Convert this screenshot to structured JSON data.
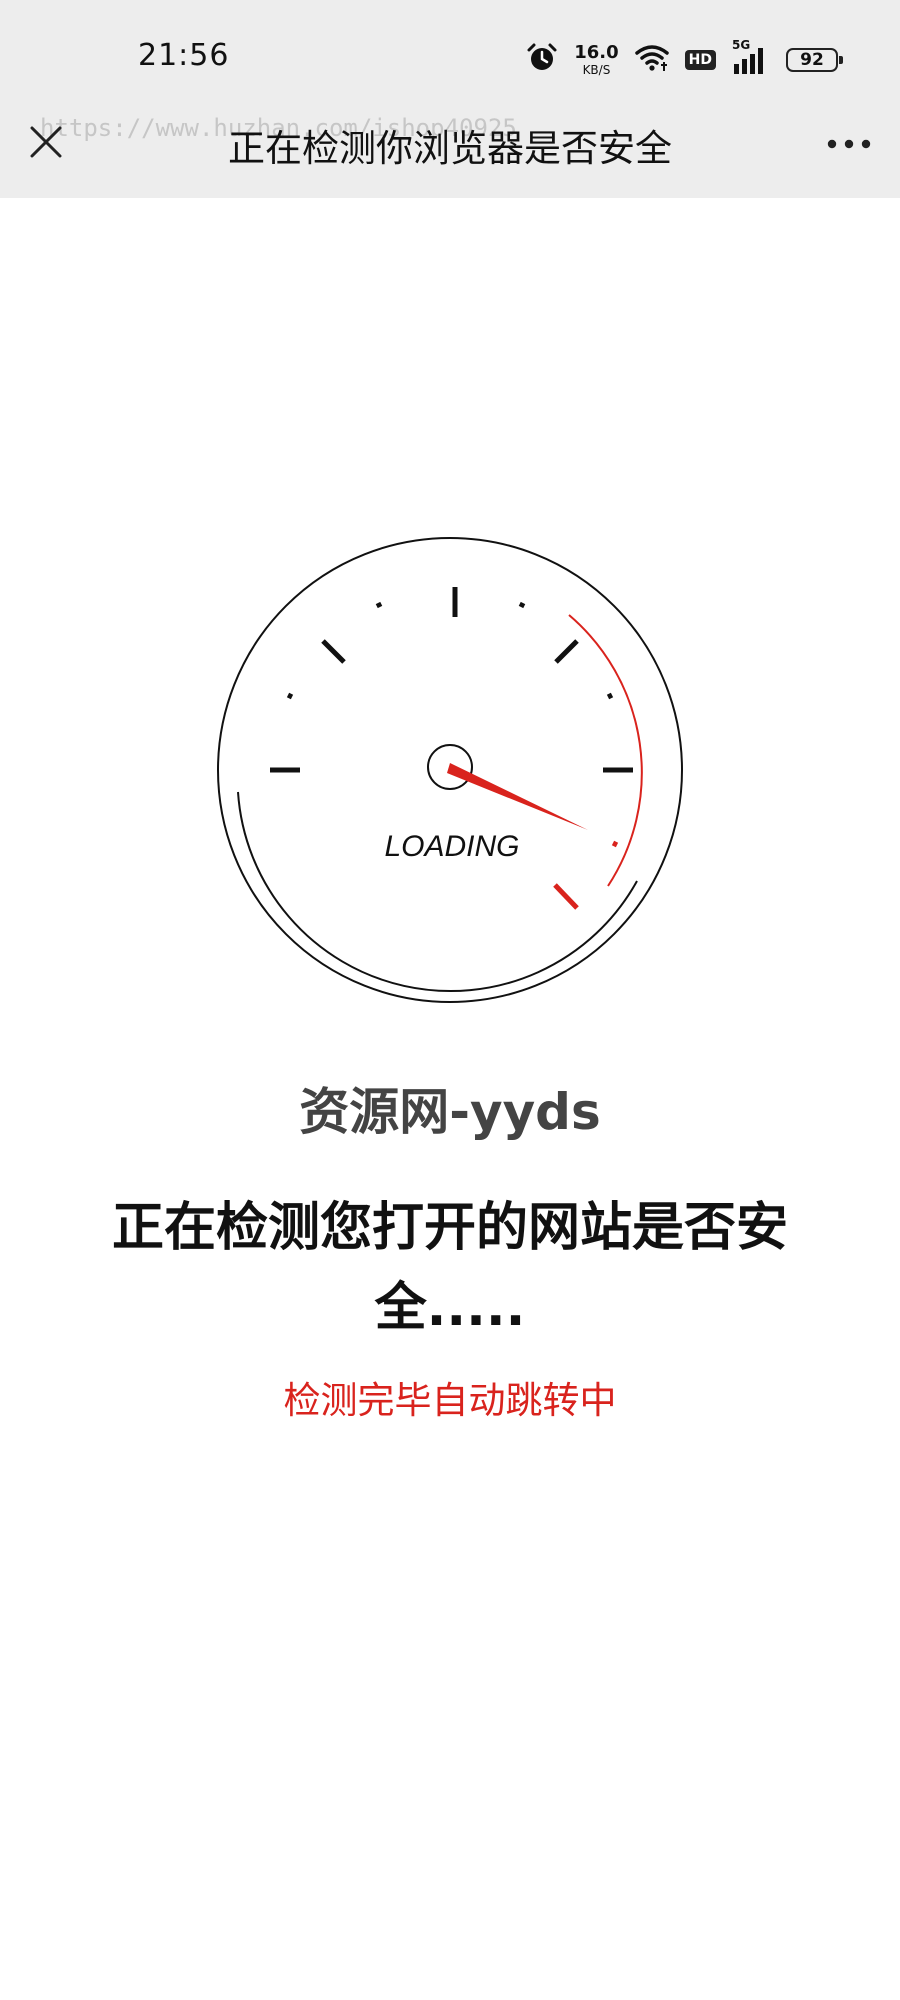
{
  "status_bar": {
    "time": "21:56",
    "net_speed_value": "16.0",
    "net_speed_unit": "KB/S",
    "hd_label": "HD",
    "signal_label": "5G",
    "battery": "92",
    "icons": [
      "alarm-icon",
      "wifi-icon",
      "signal-icon",
      "battery-icon"
    ]
  },
  "nav": {
    "title": "正在检测你浏览器是否安全",
    "watermark": "https://www.huzhan.com/ishop40925",
    "close_icon": "close-icon",
    "more_icon": "more-icon"
  },
  "gauge": {
    "label": "LOADING",
    "accent_color": "#d9231d"
  },
  "content": {
    "site_name": "资源网-yyds",
    "checking_message": "正在检测您打开的网站是否安全.....",
    "redirect_message": "检测完毕自动跳转中"
  },
  "colors": {
    "topbar": "#ededed",
    "accent": "#d9231d",
    "text": "#111111"
  }
}
